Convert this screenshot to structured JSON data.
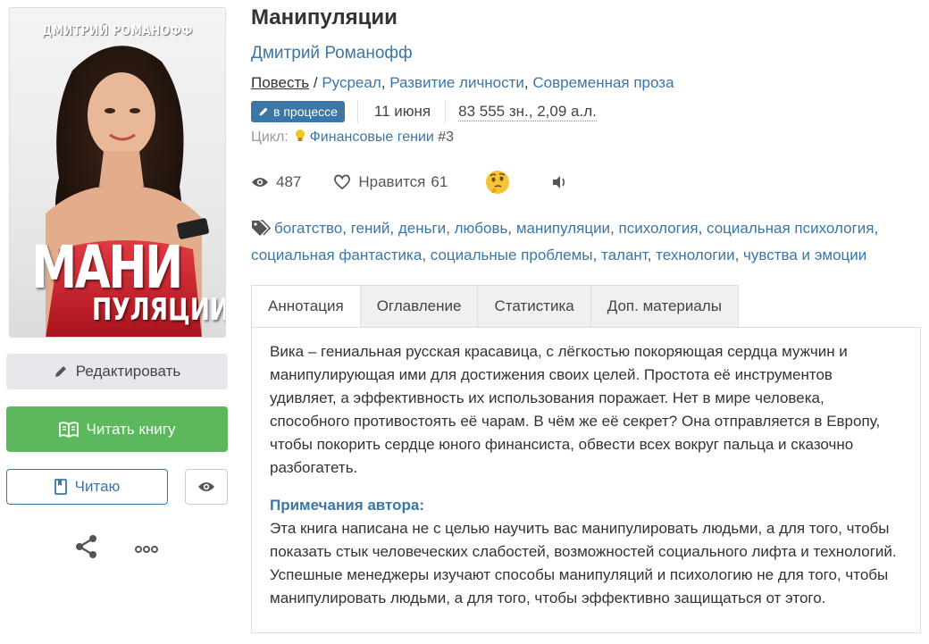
{
  "cover": {
    "author_caption": "ДМИТРИЙ РОМАНОФФ",
    "title_line1": "МАНИ",
    "title_line2": "ПУЛЯЦИИ"
  },
  "actions": {
    "edit_label": "Редактировать",
    "read_label": "Читать книгу",
    "reading_label": "Читаю"
  },
  "book": {
    "title": "Манипуляции",
    "author": "Дмитрий Романофф",
    "form": "Повесть",
    "genres": [
      "Русреал",
      "Развитие личности",
      "Современная проза"
    ],
    "status": "в процессе",
    "date": "11 июня",
    "size": "83 555 зн., 2,09 а.л.",
    "cycle_label": "Цикл:",
    "cycle_name": "Финансовые гении",
    "cycle_number": "#3"
  },
  "stats": {
    "views": "487",
    "likes_label": "Нравится",
    "likes": "61"
  },
  "tags": [
    "богатство",
    "гений",
    "деньги",
    "любовь",
    "манипуляции",
    "психология",
    "социальная психология",
    "социальная фантастика",
    "социальные проблемы",
    "талант",
    "технологии",
    "чувства и эмоции"
  ],
  "tabs": [
    "Аннотация",
    "Оглавление",
    "Статистика",
    "Доп. материалы"
  ],
  "annotation": {
    "text": "Вика – гениальная русская красавица, с лёгкостью покоряющая сердца мужчин и манипулирующая ими для достижения своих целей. Простота её инструментов удивляет, а эффективность их использования поражает. Нет в мире человека, способного противостоять её чарам. В чём же её секрет? Она отправляется в Европу, чтобы покорить сердце юного финансиста, обвести всех вокруг пальца и сказочно разбогатеть.",
    "notes_title": "Примечания автора:",
    "notes_text": "Эта книга написана не с целью научить вас манипулировать людьми, а для того, чтобы показать стык человеческих слабостей, возможностей социального лифта и технологий. Успешные менеджеры изучают способы манипуляций и психологию не для того, чтобы манипулировать людьми, а для того, чтобы эффективно защищаться от этого."
  },
  "colors": {
    "link": "#3b76a5",
    "read_button": "#5cb85c",
    "edit_button": "#e6e8eb"
  }
}
